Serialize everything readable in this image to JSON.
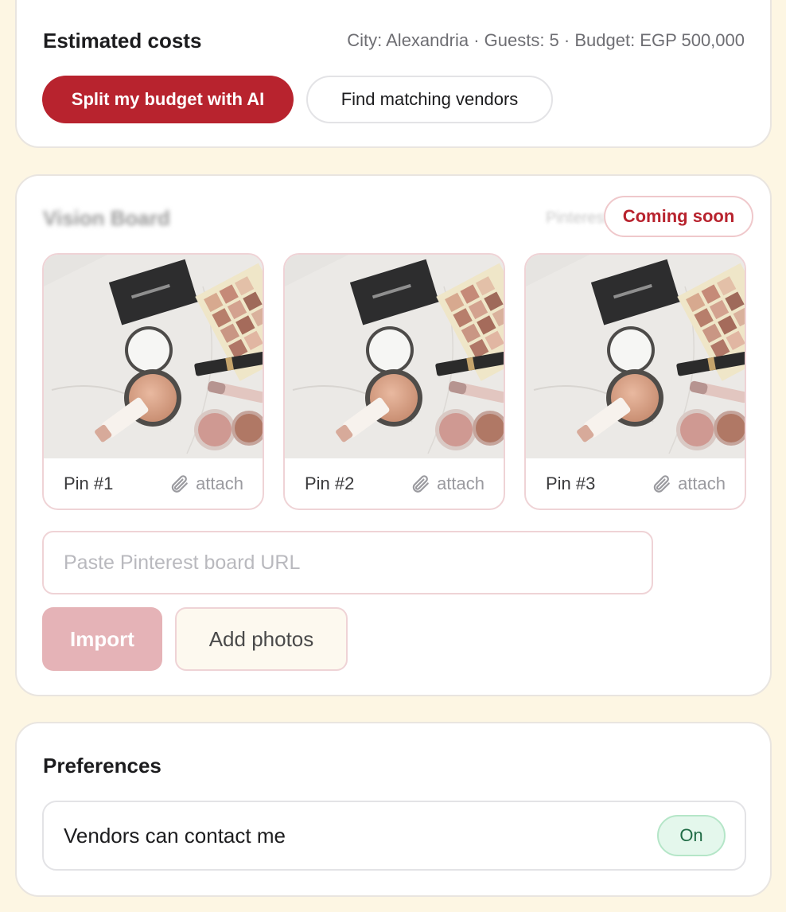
{
  "costs": {
    "title": "Estimated costs",
    "meta": "City: Alexandria · Guests: 5 · Budget: EGP 500,000",
    "split_button": "Split my budget with AI",
    "vendors_button": "Find matching vendors"
  },
  "vision": {
    "title": "Vision Board",
    "header_right": "Pinterest",
    "badge": "Coming soon",
    "pins": [
      {
        "label": "Pin #1",
        "attach": "attach"
      },
      {
        "label": "Pin #2",
        "attach": "attach"
      },
      {
        "label": "Pin #3",
        "attach": "attach"
      }
    ],
    "url_placeholder": "Paste Pinterest board URL",
    "import_button": "Import",
    "add_photos_button": "Add photos"
  },
  "preferences": {
    "title": "Preferences",
    "contact_label": "Vendors can contact me",
    "contact_toggle": "On"
  },
  "colors": {
    "page_bg": "#fdf6e3",
    "brand_red": "#b8232e",
    "import_disabled": "#e5b3b7",
    "toggle_green": "#1f6b45"
  }
}
